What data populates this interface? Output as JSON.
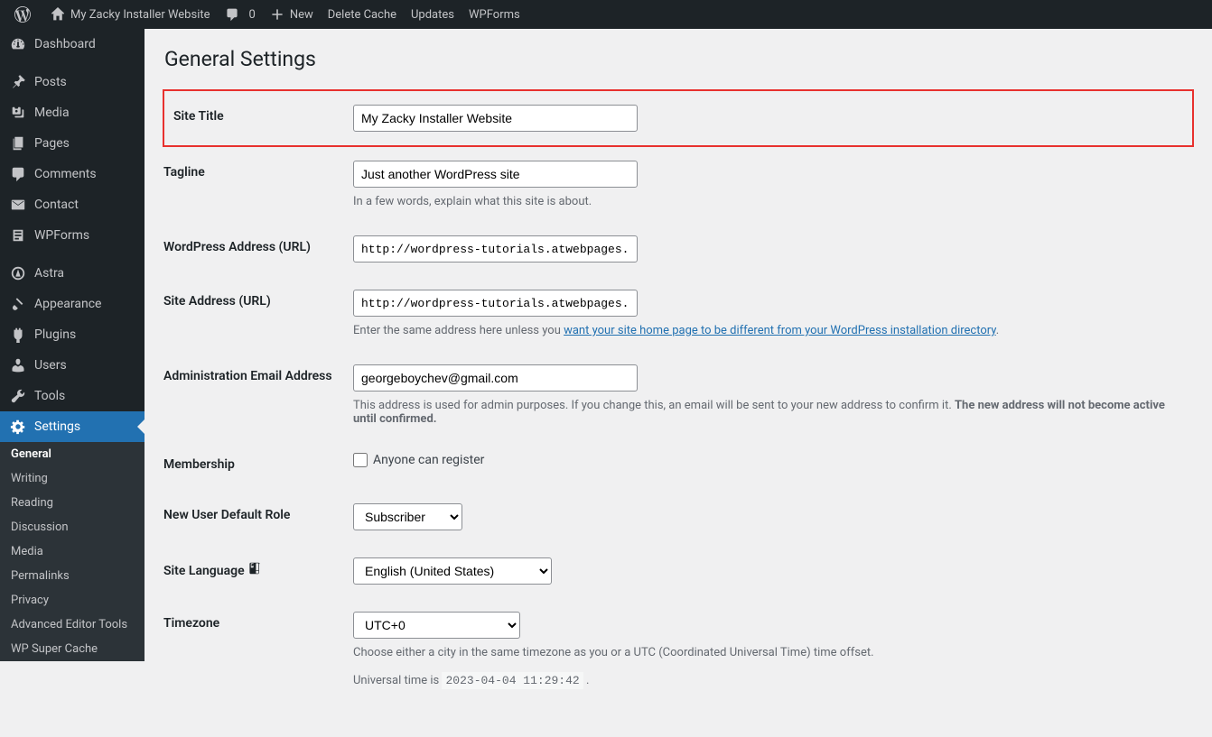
{
  "adminbar": {
    "site_name": "My Zacky Installer Website",
    "comments_count": "0",
    "new": "New",
    "delete_cache": "Delete Cache",
    "updates": "Updates",
    "wpforms": "WPForms"
  },
  "sidebar": {
    "items": [
      {
        "label": "Dashboard"
      },
      {
        "label": "Posts"
      },
      {
        "label": "Media"
      },
      {
        "label": "Pages"
      },
      {
        "label": "Comments"
      },
      {
        "label": "Contact"
      },
      {
        "label": "WPForms"
      },
      {
        "label": "Astra"
      },
      {
        "label": "Appearance"
      },
      {
        "label": "Plugins"
      },
      {
        "label": "Users"
      },
      {
        "label": "Tools"
      },
      {
        "label": "Settings"
      }
    ],
    "submenu": [
      {
        "label": "General"
      },
      {
        "label": "Writing"
      },
      {
        "label": "Reading"
      },
      {
        "label": "Discussion"
      },
      {
        "label": "Media"
      },
      {
        "label": "Permalinks"
      },
      {
        "label": "Privacy"
      },
      {
        "label": "Advanced Editor Tools"
      },
      {
        "label": "WP Super Cache"
      }
    ]
  },
  "page": {
    "title": "General Settings",
    "fields": {
      "site_title": {
        "label": "Site Title",
        "value": "My Zacky Installer Website"
      },
      "tagline": {
        "label": "Tagline",
        "value": "Just another WordPress site",
        "description": "In a few words, explain what this site is about."
      },
      "wp_url": {
        "label": "WordPress Address (URL)",
        "value": "http://wordpress-tutorials.atwebpages.com"
      },
      "site_url": {
        "label": "Site Address (URL)",
        "value": "http://wordpress-tutorials.atwebpages.com",
        "desc_pre": "Enter the same address here unless you ",
        "desc_link": "want your site home page to be different from your WordPress installation directory",
        "desc_post": "."
      },
      "admin_email": {
        "label": "Administration Email Address",
        "value": "georgeboychev@gmail.com",
        "desc_pre": "This address is used for admin purposes. If you change this, an email will be sent to your new address to confirm it. ",
        "desc_strong": "The new address will not become active until confirmed."
      },
      "membership": {
        "label": "Membership",
        "checkbox_label": "Anyone can register"
      },
      "default_role": {
        "label": "New User Default Role",
        "value": "Subscriber"
      },
      "language": {
        "label": "Site Language",
        "value": "English (United States)"
      },
      "timezone": {
        "label": "Timezone",
        "value": "UTC+0",
        "description": "Choose either a city in the same timezone as you or a UTC (Coordinated Universal Time) time offset.",
        "utime_pre": "Universal time is ",
        "utime": "2023-04-04 11:29:42",
        "utime_post": " ."
      }
    }
  }
}
